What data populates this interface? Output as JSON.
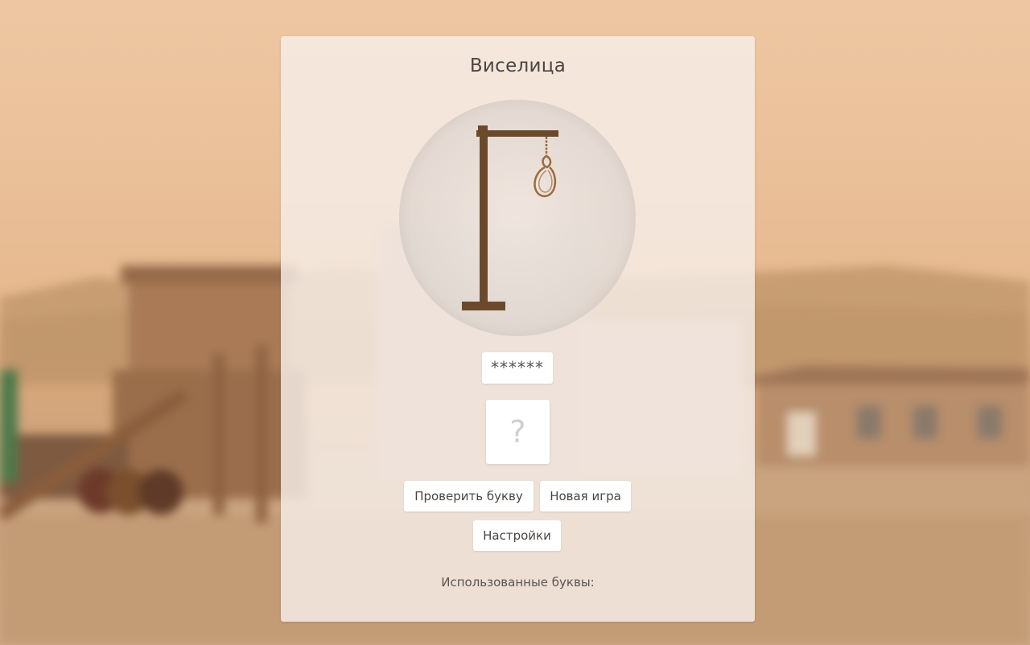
{
  "game": {
    "title": "Виселица",
    "masked_word": "******",
    "letter_placeholder": "?",
    "used_letters_label": "Использованные буквы:",
    "used_letters": ""
  },
  "buttons": {
    "check_letter": "Проверить букву",
    "new_game": "Новая игра",
    "settings": "Настройки"
  },
  "hangman": {
    "mistakes": 0,
    "stage": "gallows-and-noose-only"
  },
  "colors": {
    "gallows": "#6b4a2b",
    "rope": "#9c6a3c",
    "panel": "#f6eee9",
    "text": "#4a4542"
  },
  "icons": {
    "gallows": "gallows-icon",
    "noose": "noose-icon"
  }
}
